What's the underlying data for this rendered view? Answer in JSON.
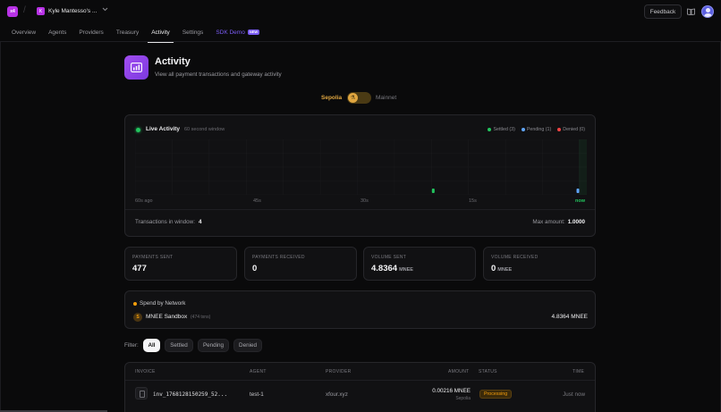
{
  "app": {
    "logo_text": "x4",
    "org_initial": "K",
    "org_name": "Kyle Mantesso's ...",
    "feedback_label": "Feedback"
  },
  "nav": {
    "items": [
      {
        "label": "Overview"
      },
      {
        "label": "Agents"
      },
      {
        "label": "Providers"
      },
      {
        "label": "Treasury"
      },
      {
        "label": "Activity",
        "active": true
      },
      {
        "label": "Settings"
      },
      {
        "label": "SDK Demo",
        "badge": "NEW"
      }
    ]
  },
  "header": {
    "title": "Activity",
    "subtitle": "View all payment transactions and gateway activity"
  },
  "network": {
    "left": "Sepolia",
    "right": "Mainnet",
    "selected": "Sepolia"
  },
  "live": {
    "title": "Live Activity",
    "window": "60 second window",
    "legend": {
      "settled": "Settled (3)",
      "pending": "Pending (1)",
      "denied": "Denied (0)"
    },
    "ticks": [
      "60s ago",
      "45s",
      "30s",
      "15s",
      "now"
    ],
    "tx_label": "Transactions in window:",
    "tx_value": "4",
    "max_label": "Max amount:",
    "max_value": "1.0000"
  },
  "chart_data": {
    "type": "scatter",
    "title": "Live Activity",
    "x": [
      -20,
      11,
      10,
      0
    ],
    "status": [
      "settled",
      "settled",
      "settled",
      "pending"
    ],
    "xlim": [
      -60,
      0
    ],
    "x_ticks": [
      "60s ago",
      "45s",
      "30s",
      "15s",
      "now"
    ],
    "colors": {
      "settled": "#22c55e",
      "pending": "#60a5fa",
      "denied": "#ef4444"
    }
  },
  "stats": [
    {
      "label": "PAYMENTS SENT",
      "value": "477",
      "unit": ""
    },
    {
      "label": "PAYMENTS RECEIVED",
      "value": "0",
      "unit": ""
    },
    {
      "label": "VOLUME SENT",
      "value": "4.8364",
      "unit": "MNEE"
    },
    {
      "label": "VOLUME RECEIVED",
      "value": "0",
      "unit": "MNEE"
    }
  ],
  "spend": {
    "title": "Spend by Network",
    "icon_letter": "S",
    "network_name": "MNEE Sandbox",
    "network_sub": "(474 txns)",
    "amount": "4.8364 MNEE"
  },
  "filters": {
    "label": "Filter:",
    "options": [
      "All",
      "Settled",
      "Pending",
      "Denied"
    ],
    "selected": "All"
  },
  "table": {
    "headers": {
      "invoice": "INVOICE",
      "agent": "AGENT",
      "provider": "PROVIDER",
      "amount": "AMOUNT",
      "status": "STATUS",
      "time": "TIME"
    },
    "rows": [
      {
        "invoice": "inv_1768128150259_52...",
        "agent": "test-1",
        "provider": "xfour.xyz",
        "amount": "0.00216 MNEE",
        "network": "Sepolia",
        "status": "Processing",
        "time": "Just now"
      }
    ]
  },
  "colors": {
    "accent": "#b832e6",
    "settled": "#22c55e",
    "pending": "#60a5fa",
    "denied": "#ef4444",
    "warning": "#f59e0b"
  }
}
